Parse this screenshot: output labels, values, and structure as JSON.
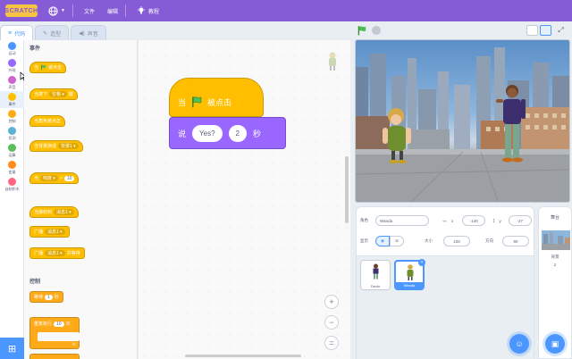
{
  "menubar": {
    "logo": "SCRATCH",
    "file": "文件",
    "edit": "编辑",
    "tutorials": "教程"
  },
  "tabs": {
    "code": "代码",
    "costumes": "造型",
    "sounds": "声音"
  },
  "categories": [
    {
      "label": "运动",
      "color": "#4c97ff"
    },
    {
      "label": "外观",
      "color": "#9966ff"
    },
    {
      "label": "声音",
      "color": "#cf63cf"
    },
    {
      "label": "事件",
      "color": "#ffbf00"
    },
    {
      "label": "控制",
      "color": "#ffab19"
    },
    {
      "label": "侦测",
      "color": "#5cb1d6"
    },
    {
      "label": "运算",
      "color": "#59c059"
    },
    {
      "label": "变量",
      "color": "#ff8c1a"
    },
    {
      "label": "自制积木",
      "color": "#ff6680"
    }
  ],
  "palette": {
    "events_title": "事件",
    "control_title": "控制",
    "blocks": {
      "when_flag_1": "当",
      "when_flag_2": "被点击",
      "when_key_1": "当按下",
      "when_key_drop": "空格 ▾",
      "when_key_2": "键",
      "when_sprite_clicked": "当角色被点击",
      "when_backdrop_1": "当背景换成",
      "when_backdrop_drop": "背景1 ▾",
      "when_gt_1": "当",
      "when_gt_drop": "响度 ▾",
      "when_gt_sym": ">",
      "when_gt_val": "10",
      "when_recv_1": "当接收到",
      "when_recv_drop": "消息1 ▾",
      "broadcast_1": "广播",
      "broadcast_drop": "消息1 ▾",
      "broadcast_wait_1": "广播",
      "broadcast_wait_drop": "消息1 ▾",
      "broadcast_wait_2": "并等待",
      "wait_1": "等待",
      "wait_val": "1",
      "wait_2": "秒",
      "repeat_1": "重复执行",
      "repeat_val": "10",
      "repeat_2": "次"
    }
  },
  "script": {
    "hat_when": "当",
    "hat_clicked": "被点击",
    "say": "说",
    "say_text": "Yes?",
    "say_secs": "2",
    "say_unit": "秒"
  },
  "zoom": {
    "zoom_in": "+",
    "zoom_out": "−",
    "reset": "="
  },
  "sprite_info": {
    "sprite_label": "角色",
    "sprite_name": "Wanda",
    "x_label": "x",
    "x_value": "-140",
    "y_label": "y",
    "y_value": "-27",
    "show_label": "显示",
    "size_label": "大小",
    "size_value": "100",
    "direction_label": "方向",
    "direction_value": "90"
  },
  "sprites": [
    {
      "name": "Devin",
      "selected": false
    },
    {
      "name": "Wanda",
      "selected": true
    }
  ],
  "stage_pane": {
    "title": "舞台",
    "backdrops_label": "背景",
    "backdrops_count": "2"
  },
  "colors": {
    "menubar": "#855cd6",
    "events": "#ffbf00",
    "control": "#ffab19",
    "looks": "#9966ff",
    "accent": "#4c97ff"
  }
}
